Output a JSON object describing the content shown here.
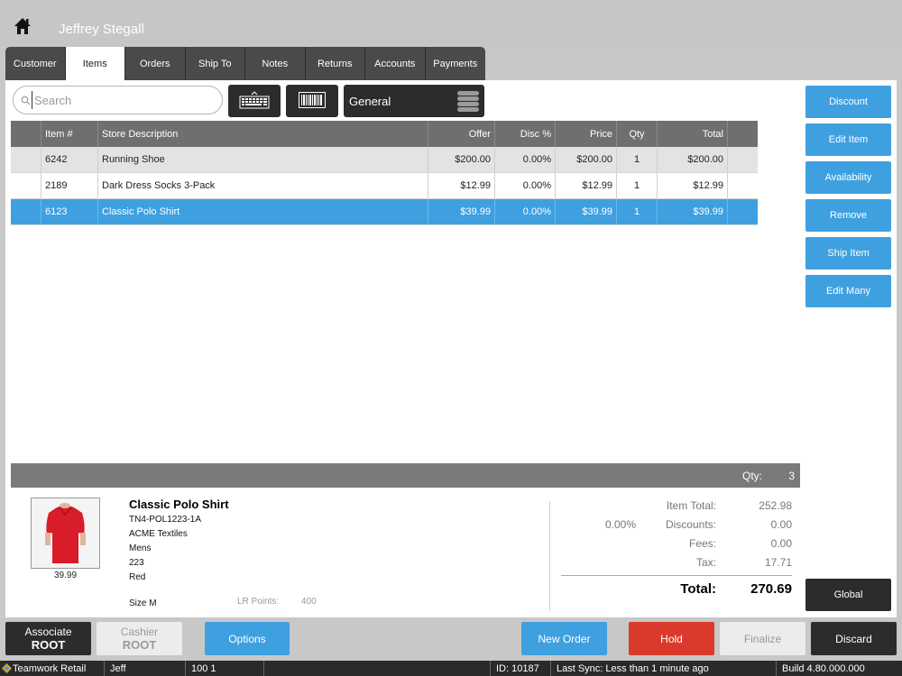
{
  "header": {
    "customer_name": "Jeffrey Stegall"
  },
  "tabs": [
    {
      "label": "Customer",
      "active": false
    },
    {
      "label": "Items",
      "active": true
    },
    {
      "label": "Orders",
      "active": false
    },
    {
      "label": "Ship To",
      "active": false
    },
    {
      "label": "Notes",
      "active": false
    },
    {
      "label": "Returns",
      "active": false
    },
    {
      "label": "Accounts",
      "active": false
    },
    {
      "label": "Payments",
      "active": false
    }
  ],
  "search": {
    "placeholder": "Search",
    "value": ""
  },
  "price_list": {
    "selected": "General"
  },
  "table": {
    "columns": [
      "",
      "Item #",
      "Store Description",
      "Offer",
      "Disc %",
      "Price",
      "Qty",
      "Total",
      ""
    ],
    "rows": [
      {
        "item": "6242",
        "description": "Running Shoe",
        "offer": "$200.00",
        "disc": "0.00%",
        "price": "$200.00",
        "qty": "1",
        "total": "$200.00"
      },
      {
        "item": "2189",
        "description": "Dark Dress Socks 3-Pack",
        "offer": "$12.99",
        "disc": "0.00%",
        "price": "$12.99",
        "qty": "1",
        "total": "$12.99"
      },
      {
        "item": "6123",
        "description": "Classic Polo Shirt",
        "offer": "$39.99",
        "disc": "0.00%",
        "price": "$39.99",
        "qty": "1",
        "total": "$39.99"
      }
    ]
  },
  "qty_bar": {
    "label": "Qty:",
    "value": "3"
  },
  "product": {
    "name": "Classic Polo Shirt",
    "sku": "TN4-POL1223-1A",
    "vendor": "ACME Textiles",
    "department": "Mens",
    "style": "223",
    "color": "Red",
    "size": "Size M",
    "price": "39.99",
    "lr_label": "LR Points:",
    "lr_value": "400"
  },
  "summary": {
    "item_total_label": "Item Total:",
    "item_total": "252.98",
    "discount_pct": "0.00%",
    "discounts_label": "Discounts:",
    "discounts": "0.00",
    "fees_label": "Fees:",
    "fees": "0.00",
    "tax_label": "Tax:",
    "tax": "17.71",
    "total_label": "Total:",
    "total": "270.69"
  },
  "side_buttons": [
    "Discount",
    "Edit Item",
    "Availability",
    "Remove",
    "Ship Item",
    "Edit Many"
  ],
  "global_label": "Global",
  "bottom": {
    "associate_label": "Associate",
    "associate_value": "ROOT",
    "cashier_label": "Cashier",
    "cashier_value": "ROOT",
    "options": "Options",
    "new_order": "New Order",
    "hold": "Hold",
    "finalize": "Finalize",
    "discard": "Discard"
  },
  "status": {
    "app": "Teamwork Retail",
    "user": "Jeff",
    "location": "100 1",
    "id": "ID: 10187",
    "sync": "Last Sync: Less than 1 minute ago",
    "build": "Build 4.80.000.000"
  },
  "colors": {
    "accent": "#3fa0e0",
    "hold": "#d93a2b",
    "dark": "#2c2c2c"
  }
}
